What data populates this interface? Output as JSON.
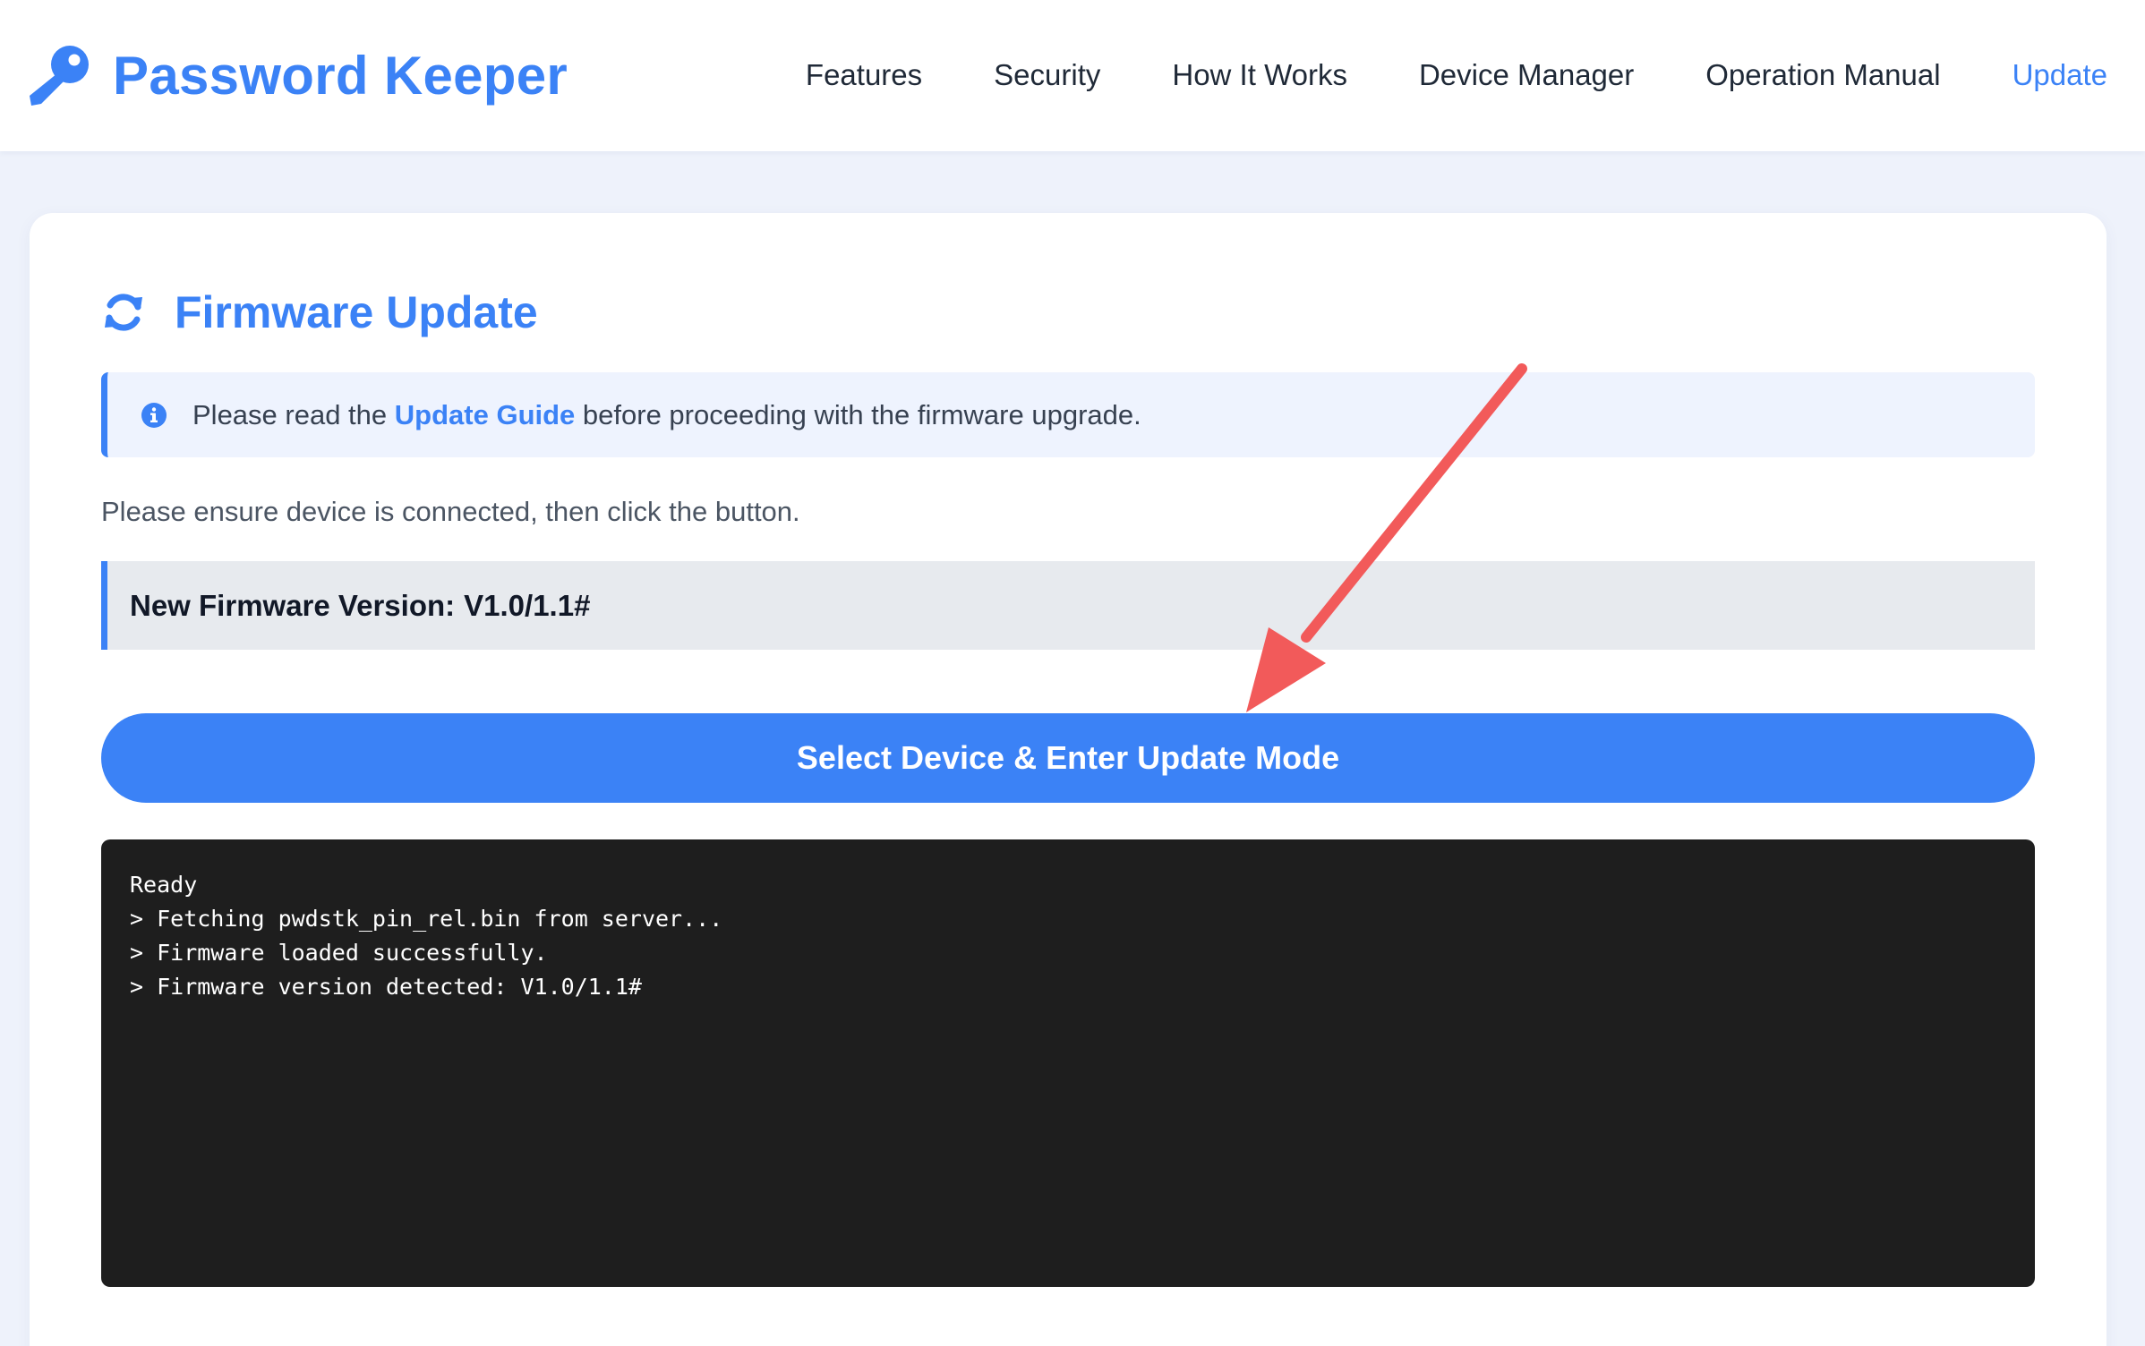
{
  "header": {
    "brand_name": "Password Keeper",
    "brand_icon": "key-icon",
    "nav": [
      {
        "label": "Features",
        "active": false
      },
      {
        "label": "Security",
        "active": false
      },
      {
        "label": "How It Works",
        "active": false
      },
      {
        "label": "Device Manager",
        "active": false
      },
      {
        "label": "Operation Manual",
        "active": false
      },
      {
        "label": "Update",
        "active": true
      }
    ]
  },
  "main": {
    "title": "Firmware Update",
    "title_icon": "sync-icon",
    "info": {
      "icon": "info-icon",
      "prefix": "Please read the",
      "link": "Update Guide",
      "suffix": "before proceeding with the firmware upgrade."
    },
    "instruction": "Please ensure device is connected, then click the button.",
    "version": {
      "label": "New Firmware Version:",
      "value": "V1.0/1.1#"
    },
    "button_label": "Select Device & Enter Update Mode",
    "console_lines": [
      "Ready",
      "> Fetching pwdstk_pin_rel.bin from server...",
      "> Firmware loaded successfully.",
      "> Firmware version detected: V1.0/1.1#"
    ]
  },
  "colors": {
    "accent": "#3b82f6",
    "page_background": "#eef2fb",
    "info_background": "#eef3fe",
    "version_background": "#e7eaee",
    "console_background": "#1e1e1e",
    "annotation_arrow": "#f25a5a"
  }
}
